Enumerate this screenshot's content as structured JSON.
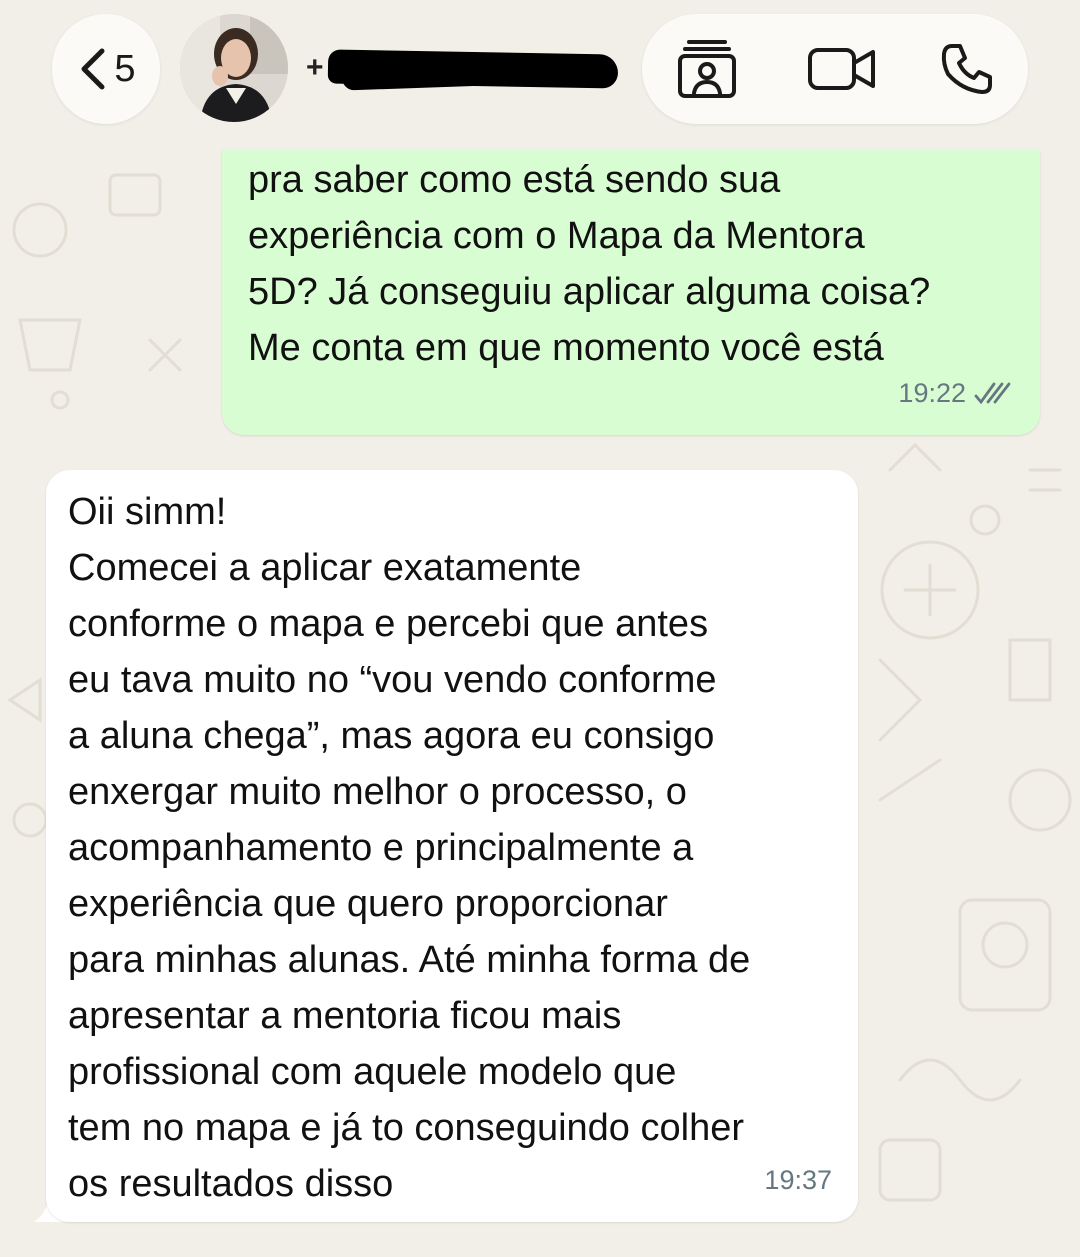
{
  "header": {
    "back_count": "5",
    "contact_prefix": "+",
    "icons": {
      "back": "chevron-left-icon",
      "avatar": "contact-avatar",
      "contact_card": "contact-card-icon",
      "video": "video-camera-icon",
      "call": "phone-icon"
    }
  },
  "messages": [
    {
      "direction": "outgoing",
      "text": "pra saber como está sendo sua\nexperiência com o Mapa da Mentora\n5D? Já conseguiu aplicar alguma coisa?\nMe conta em que momento você está",
      "time": "19:22",
      "status_icon": "double-check-icon"
    },
    {
      "direction": "incoming",
      "text": "Oii simm!\nComecei a aplicar exatamente\nconforme o mapa e percebi que antes\neu tava muito no “vou vendo conforme\na aluna chega”, mas agora eu consigo\nenxergar muito melhor o processo, o\nacompanhamento e principalmente a\nexperiência que quero proporcionar\npara minhas alunas. Até minha forma de\napresentar a mentoria ficou mais\nprofissional com aquele modelo que\ntem no mapa e já to conseguindo colher\nos resultados disso",
      "time": "19:37"
    }
  ],
  "colors": {
    "background": "#f2efe8",
    "outgoing_bubble": "#d9fdd3",
    "incoming_bubble": "#ffffff",
    "meta_text": "#667781"
  }
}
